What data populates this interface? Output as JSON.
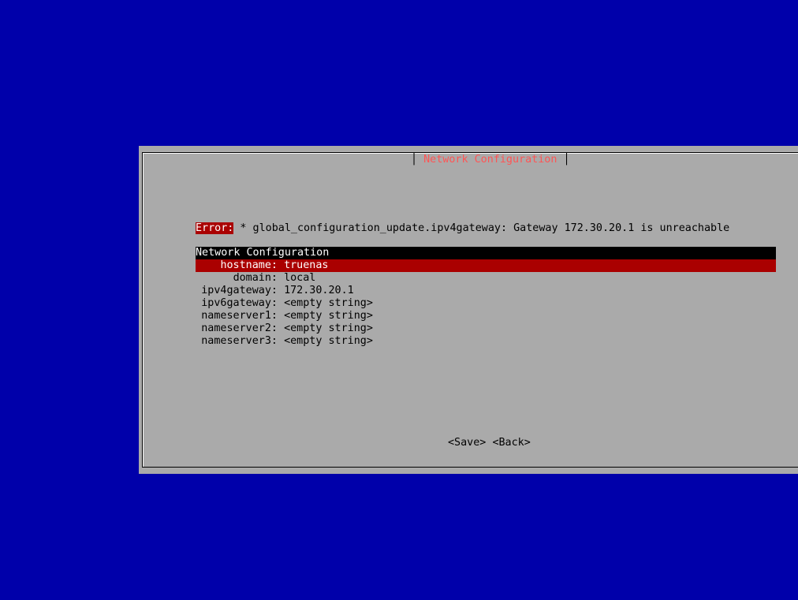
{
  "dialog": {
    "title": "Network Configuration"
  },
  "error": {
    "label": "Error:",
    "message": " * global_configuration_update.ipv4gateway: Gateway 172.30.20.1 is unreachable"
  },
  "form": {
    "header": "Network Configuration",
    "fields": [
      {
        "key": "hostname:",
        "value": "truenas"
      },
      {
        "key": "domain:",
        "value": "local"
      },
      {
        "key": "ipv4gateway:",
        "value": "172.30.20.1"
      },
      {
        "key": "ipv6gateway:",
        "value": "<empty string>"
      },
      {
        "key": "nameserver1:",
        "value": "<empty string>"
      },
      {
        "key": "nameserver2:",
        "value": "<empty string>"
      },
      {
        "key": "nameserver3:",
        "value": "<empty string>"
      }
    ]
  },
  "buttons": {
    "save": "<Save>",
    "back": "<Back>"
  },
  "colors": {
    "background": "#0000aa",
    "dialog": "#aaaaaa",
    "title": "#ff5555",
    "error_bg": "#aa0000",
    "selected_bg": "#aa0000",
    "header_bg": "#000000"
  }
}
